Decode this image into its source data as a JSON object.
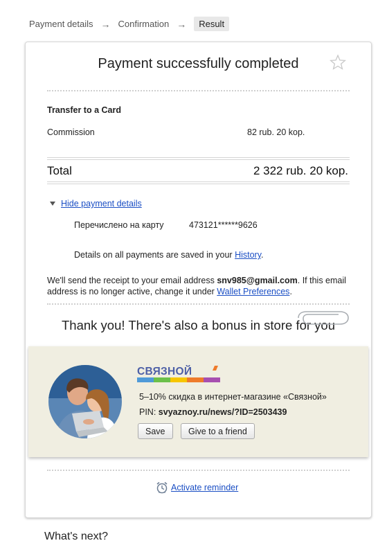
{
  "breadcrumbs": {
    "step1": "Payment details",
    "step2": "Confirmation",
    "step3": "Result",
    "arrow": "→"
  },
  "header": {
    "title": "Payment successfully completed",
    "favorite_icon": "star-outline-icon"
  },
  "summary": {
    "type": "Transfer to a Card",
    "commission_label": "Commission",
    "commission_value": "82 rub. 20 kop.",
    "total_label": "Total",
    "total_value": "2 322 rub. 20 kop."
  },
  "details": {
    "toggle_label": "Hide payment details",
    "row_label": "Перечислено на карту",
    "row_value": "473121******9626",
    "history_prefix": "Details on all payments are saved in your ",
    "history_link": "History",
    "history_suffix": "."
  },
  "receipt": {
    "prefix": "We'll send the receipt to your email address ",
    "email": "snv985@gmail.com",
    "middle": ". If this email address is no longer active, change it under ",
    "link": "Wallet Preferences",
    "suffix": "."
  },
  "bonus": {
    "heading": "Thank you! There's also a bonus in store for you",
    "brand": "СВЯЗНОЙ",
    "description": "5–10% скидка в интернет-магазине «Связной»",
    "pin_label": "PIN: ",
    "pin_value": "svyaznoy.ru/news/?ID=2503439",
    "save_label": "Save",
    "friend_label": "Give to a friend"
  },
  "reminder": {
    "icon": "alarm-clock-icon",
    "label": "Activate reminder"
  },
  "footer": {
    "partial_heading": "What's next?"
  },
  "colors": {
    "link": "#1a4ec4",
    "promo_background": "#f0eee1",
    "brand_text": "#4d5fa6",
    "brand_stripes": [
      "#4f9ad8",
      "#6cc04a",
      "#f7c600",
      "#ee7b2b",
      "#a74fb0"
    ]
  }
}
